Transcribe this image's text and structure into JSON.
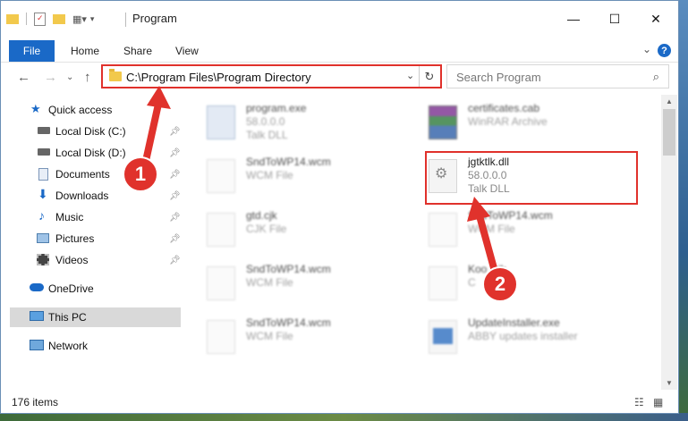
{
  "window": {
    "title": "Program",
    "controls": {
      "minimize": "—",
      "maximize": "☐",
      "close": "✕"
    }
  },
  "ribbon": {
    "tabs": [
      "File",
      "Home",
      "Share",
      "View"
    ],
    "help": "?"
  },
  "nav": {
    "address": "C:\\Program Files\\Program Directory",
    "search_placeholder": "Search Program"
  },
  "sidebar": {
    "items": [
      {
        "label": "Quick access",
        "icon": "star-icon"
      },
      {
        "label": "Local Disk (C:)",
        "icon": "drive-icon"
      },
      {
        "label": "Local Disk (D:)",
        "icon": "drive-icon"
      },
      {
        "label": "Documents",
        "icon": "documents-icon"
      },
      {
        "label": "Downloads",
        "icon": "download-icon"
      },
      {
        "label": "Music",
        "icon": "music-icon"
      },
      {
        "label": "Pictures",
        "icon": "pictures-icon"
      },
      {
        "label": "Videos",
        "icon": "videos-icon"
      },
      {
        "label": "OneDrive",
        "icon": "cloud-icon"
      },
      {
        "label": "This PC",
        "icon": "computer-icon"
      },
      {
        "label": "Network",
        "icon": "network-icon"
      }
    ]
  },
  "files": [
    {
      "name": "program.exe",
      "size": "58.0.0.0",
      "type": "Talk DLL"
    },
    {
      "name": "certificates.cab",
      "size": "",
      "type": "WinRAR Archive"
    },
    {
      "name": "SndToWP14.wcm",
      "size": "",
      "type": "WCM File"
    },
    {
      "name": "jgtktlk.dll",
      "size": "58.0.0.0",
      "type": "Talk DLL"
    },
    {
      "name": "gtd.cjk",
      "size": "",
      "type": "CJK File"
    },
    {
      "name": "SndToWP14.wcm",
      "size": "",
      "type": "WCM File"
    },
    {
      "name": "SndToWP14.wcm",
      "size": "",
      "type": "WCM File"
    },
    {
      "name": "Koo    .cjk",
      "size": "",
      "type": "C"
    },
    {
      "name": "SndToWP14.wcm",
      "size": "",
      "type": "WCM File"
    },
    {
      "name": "UpdateInstaller.exe",
      "size": "",
      "type": "ABBY updates installer"
    }
  ],
  "status": {
    "count": "176 items"
  },
  "callouts": [
    "1",
    "2"
  ],
  "colors": {
    "accent": "#1a69c7",
    "highlight": "#e0312b",
    "badge": "#e0322c"
  }
}
